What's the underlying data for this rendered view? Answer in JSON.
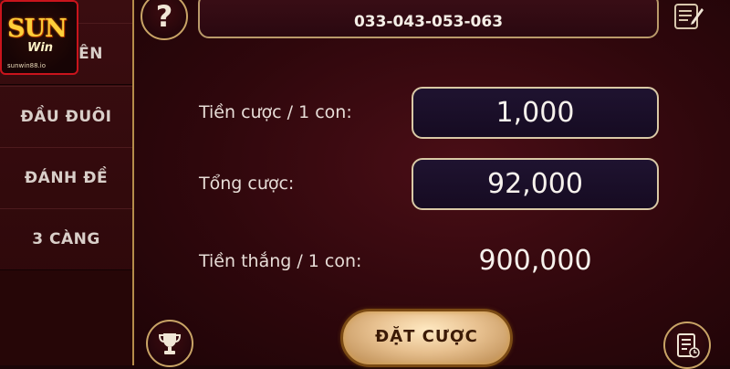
{
  "logo": {
    "word": "SUN",
    "sub": "Win",
    "url": "sunwin88.io"
  },
  "sidebar": {
    "items": [
      {
        "label": "ÊN"
      },
      {
        "label": "ĐẦU ĐUÔI"
      },
      {
        "label": "ĐÁNH ĐỀ"
      },
      {
        "label": "3 CÀNG"
      }
    ]
  },
  "header": {
    "help_glyph": "?",
    "numbers": "033-043-053-063"
  },
  "form": {
    "bet_per_label": "Tiền cược / 1 con:",
    "bet_per_value": "1,000",
    "total_label": "Tổng cược:",
    "total_value": "92,000",
    "win_label": "Tiền thắng / 1 con:",
    "win_value": "900,000"
  },
  "actions": {
    "bet_button": "ĐẶT CƯỢC"
  },
  "icons": {
    "help": "question-icon",
    "edit": "edit-icon",
    "trophy": "trophy-icon",
    "history": "history-icon"
  },
  "colors": {
    "gold_border": "#c9a466",
    "background": "#2f070c",
    "field_bg": "#1f1330"
  }
}
